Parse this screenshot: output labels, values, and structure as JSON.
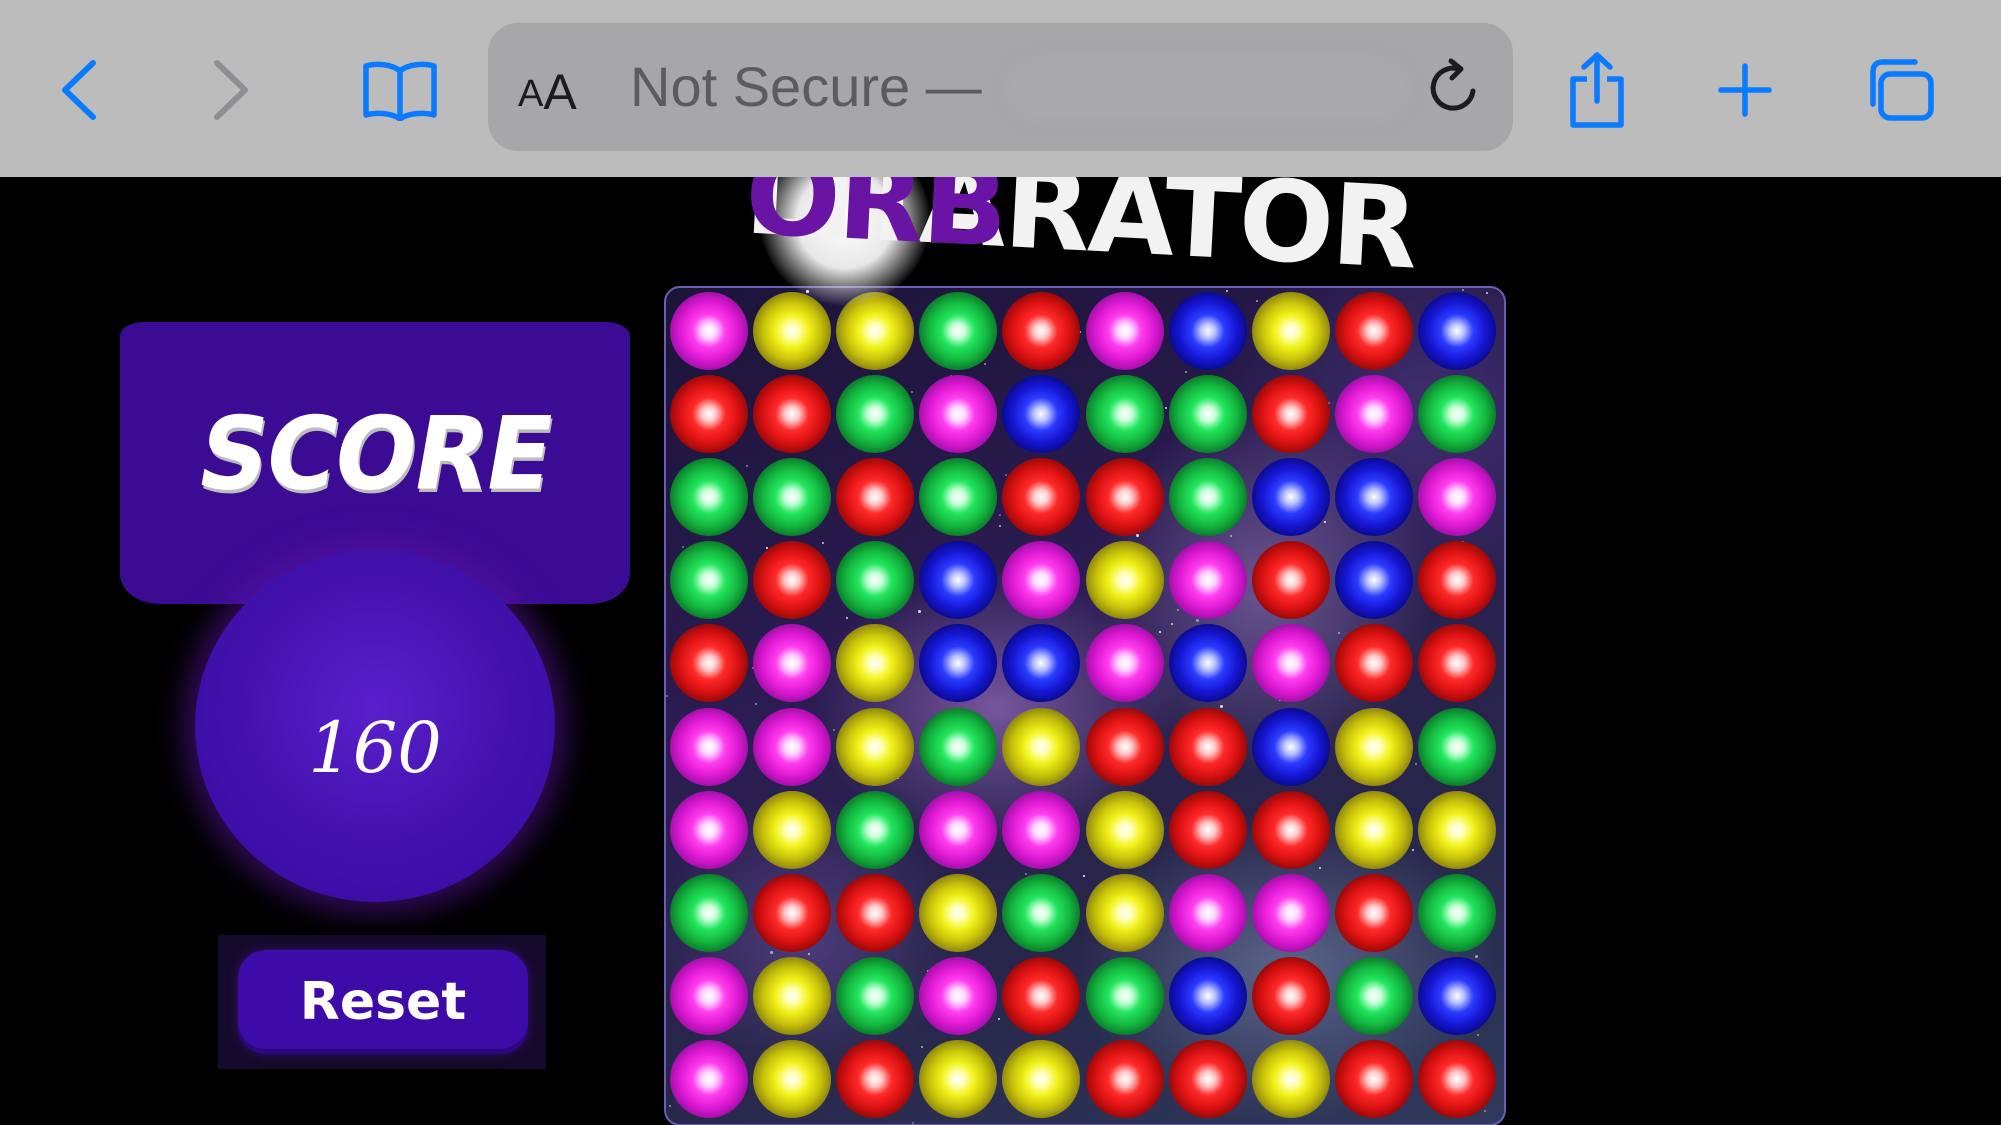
{
  "browser": {
    "reader_button_small": "A",
    "reader_button_big": "A",
    "url_text": "Not Secure —",
    "icons": {
      "back": "chevron-left-icon",
      "forward": "chevron-right-icon",
      "bookmarks": "book-icon",
      "reload": "reload-icon",
      "share": "share-icon",
      "new_tab": "plus-icon",
      "tabs": "tabs-icon"
    },
    "accent_color": "#0a7aff"
  },
  "game": {
    "title_part1": "ORB",
    "title_part2": "LITARATOR",
    "score_label": "SCORE",
    "score_value": "160",
    "reset_label": "Reset",
    "colors": {
      "panel": "#3c0b94",
      "title_orb": "#6a14a6"
    },
    "board": {
      "rows": 10,
      "cols": 10,
      "cells": [
        [
          "magenta",
          "yellow",
          "yellow",
          "green",
          "red",
          "magenta",
          "blue",
          "yellow",
          "red",
          "blue"
        ],
        [
          "red",
          "red",
          "green",
          "magenta",
          "blue",
          "green",
          "green",
          "red",
          "magenta",
          "green"
        ],
        [
          "green",
          "green",
          "red",
          "green",
          "red",
          "red",
          "green",
          "blue",
          "blue",
          "magenta"
        ],
        [
          "green",
          "red",
          "green",
          "blue",
          "magenta",
          "yellow",
          "magenta",
          "red",
          "blue",
          "red"
        ],
        [
          "red",
          "magenta",
          "yellow",
          "blue",
          "blue",
          "magenta",
          "blue",
          "magenta",
          "red",
          "red"
        ],
        [
          "magenta",
          "magenta",
          "yellow",
          "green",
          "yellow",
          "red",
          "red",
          "blue",
          "yellow",
          "green"
        ],
        [
          "magenta",
          "yellow",
          "green",
          "magenta",
          "magenta",
          "yellow",
          "red",
          "red",
          "yellow",
          "yellow"
        ],
        [
          "green",
          "red",
          "red",
          "yellow",
          "green",
          "yellow",
          "magenta",
          "magenta",
          "red",
          "green"
        ],
        [
          "magenta",
          "yellow",
          "green",
          "magenta",
          "red",
          "green",
          "blue",
          "red",
          "green",
          "blue"
        ],
        [
          "magenta",
          "yellow",
          "red",
          "yellow",
          "yellow",
          "red",
          "red",
          "yellow",
          "red",
          "red"
        ]
      ]
    }
  }
}
